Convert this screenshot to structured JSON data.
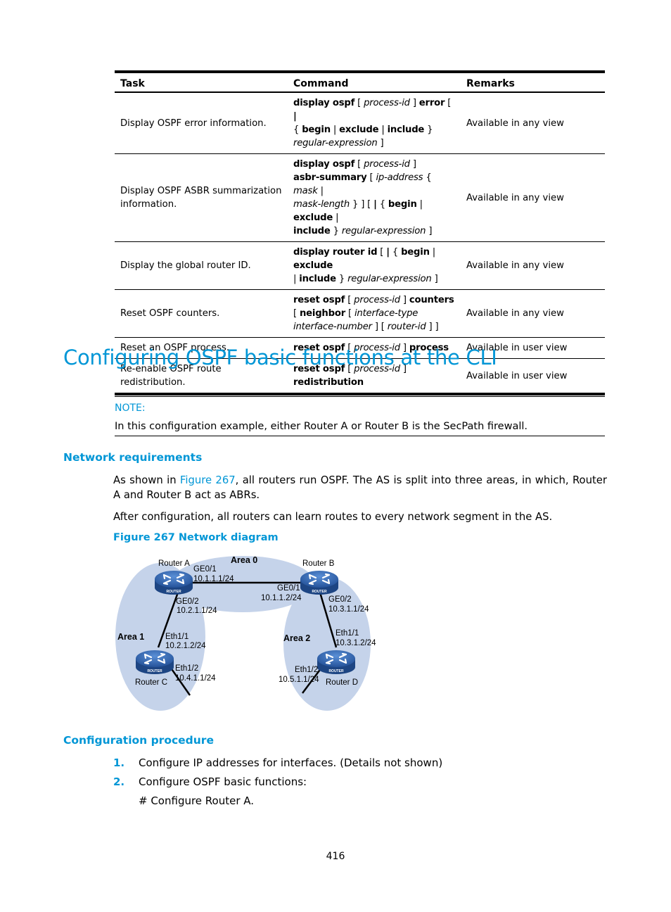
{
  "table": {
    "headers": [
      "Task",
      "Command",
      "Remarks"
    ],
    "rows": [
      {
        "task": "Display OSPF error information.",
        "remarks": "Available in any view"
      },
      {
        "task": "Display OSPF ASBR summarization information.",
        "remarks": "Available in any view"
      },
      {
        "task": "Display the global router ID.",
        "remarks": "Available in any view"
      },
      {
        "task": "Reset OSPF counters.",
        "remarks": "Available in any view"
      },
      {
        "task": "Reset an OSPF process.",
        "remarks": "Available in user view"
      },
      {
        "task": "Re-enable OSPF route redistribution.",
        "remarks": "Available in user view"
      }
    ],
    "commands": {
      "r0": {
        "a": "display ospf",
        "b": " [ ",
        "c": "process-id",
        "d": " ] ",
        "e": "error",
        "f": " [ ",
        "g": "|",
        "h": "{ ",
        "i": "begin",
        "j": " | ",
        "k": "exclude",
        "l": " | ",
        "m": "include",
        "n": " }",
        "o": "regular-expression",
        "p": " ]"
      },
      "r1": {
        "a": "display ospf",
        "b": " [ ",
        "c": "process-id",
        "d": " ]",
        "e": "asbr-summary",
        "f": " [ ",
        "g": "ip-address",
        "h": " { ",
        "i": "mask",
        "j": " | ",
        "k": "mask-length",
        "l": " } ] [ ",
        "m": "|",
        "n": " { ",
        "o": "begin",
        "p": " | ",
        "q": "exclude",
        "r": " |",
        "s": "include",
        "t": " } ",
        "u": "regular-expression",
        "v": " ]"
      },
      "r2": {
        "a": "display router id",
        "b": " [ ",
        "c": "|",
        "d": " { ",
        "e": "begin",
        "f": " | ",
        "g": "exclude",
        "h": "| ",
        "i": "include",
        "j": " } ",
        "k": "regular-expression",
        "l": " ]"
      },
      "r3": {
        "a": "reset ospf",
        "b": " [ ",
        "c": "process-id",
        "d": " ] ",
        "e": "counters",
        "f": "[ ",
        "g": "neighbor",
        "h": " [ ",
        "i": "interface-type",
        "j": "interface-number",
        "k": " ] [ ",
        "l": "router-id",
        "m": " ] ]"
      },
      "r4": {
        "a": "reset ospf",
        "b": " [ ",
        "c": "process-id",
        "d": " ] ",
        "e": "process"
      },
      "r5": {
        "a": "reset ospf",
        "b": " [ ",
        "c": "process-id",
        "d": " ] ",
        "e": "redistribution"
      }
    }
  },
  "section_title": "Configuring OSPF basic functions at the CLI",
  "note": {
    "label": "NOTE:",
    "text": "In this configuration example, either Router A or Router B is the SecPath firewall."
  },
  "network_requirements": {
    "heading": "Network requirements",
    "para1_pre": "As shown in ",
    "para1_link": "Figure 267",
    "para1_post": ", all routers run OSPF. The AS is split into three areas, in which, Router A and Router B act as ABRs.",
    "para2": "After configuration, all routers can learn routes to every network segment in the AS.",
    "figure_caption": "Figure 267 Network diagram"
  },
  "diagram": {
    "areas": [
      "Area 0",
      "Area 1",
      "Area 2"
    ],
    "routers": {
      "a": "Router A",
      "b": "Router B",
      "c": "Router C",
      "d": "Router D",
      "badge": "ROUTER"
    },
    "interfaces": {
      "a_ge01": "GE0/1",
      "a_ge01_ip": "10.1.1.1/24",
      "a_ge02": "GE0/2",
      "a_ge02_ip": "10.2.1.1/24",
      "b_ge01": "GE0/1",
      "b_ge01_ip": "10.1.1.2/24",
      "b_ge02": "GE0/2",
      "b_ge02_ip": "10.3.1.1/24",
      "c_eth11": "Eth1/1",
      "c_eth11_ip": "10.2.1.2/24",
      "c_eth12": "Eth1/2",
      "c_eth12_ip": "10.4.1.1/24",
      "d_eth11": "Eth1/1",
      "d_eth11_ip": "10.3.1.2/24",
      "d_eth12": "Eth1/2",
      "d_eth12_ip": "10.5.1.1/24"
    },
    "colors": {
      "area_fill": "#c5d3ea",
      "router_fill": "#3a6fb8"
    }
  },
  "configuration_procedure": {
    "heading": "Configuration procedure",
    "steps": [
      {
        "num": "1.",
        "text": "Configure IP addresses for interfaces. (Details not shown)"
      },
      {
        "num": "2.",
        "text": "Configure OSPF basic functions:"
      }
    ],
    "comment": "# Configure Router A."
  },
  "page_number": "416"
}
